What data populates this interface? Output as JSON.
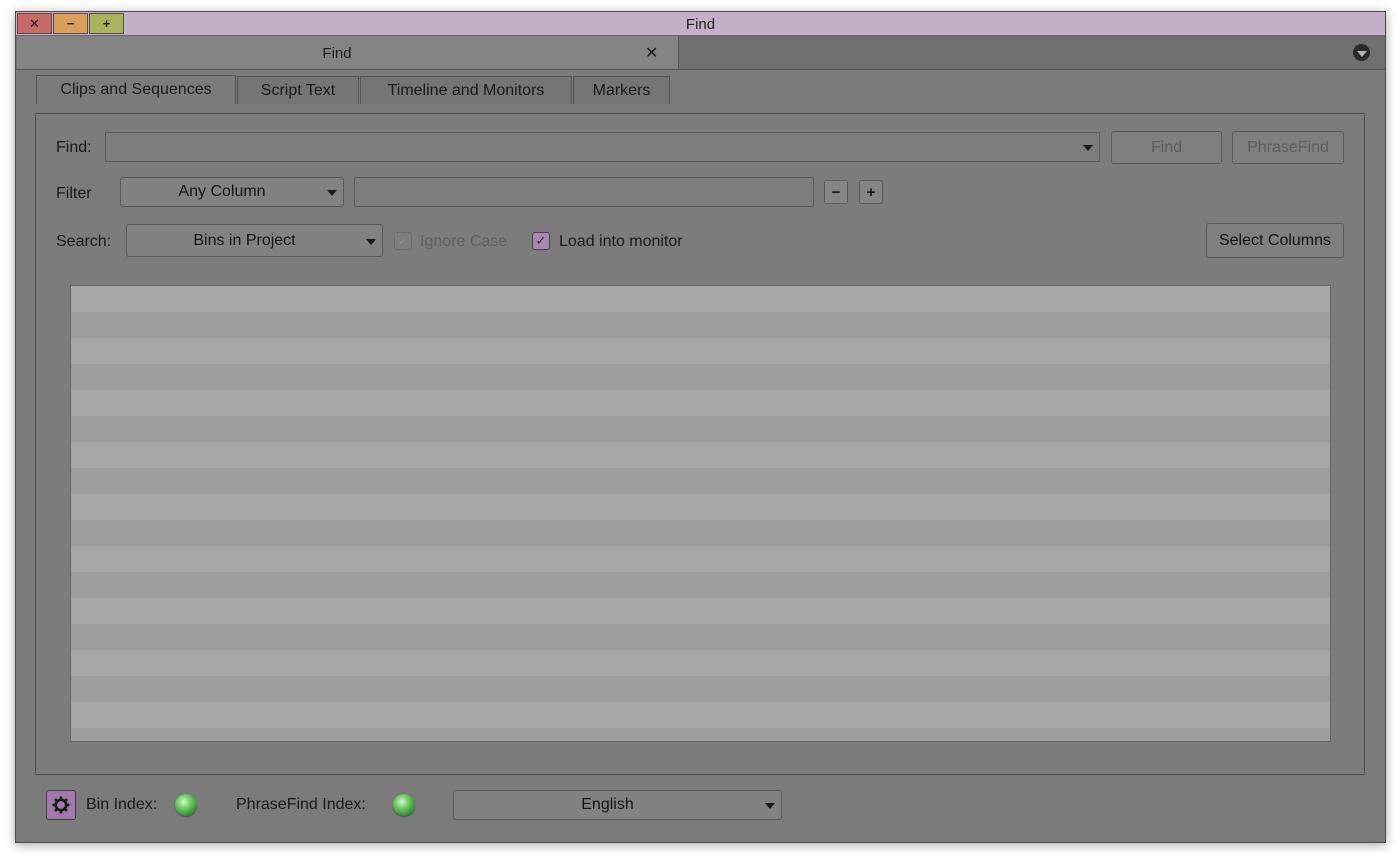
{
  "window": {
    "title": "Find",
    "controls": {
      "close": "✕",
      "minimize": "−",
      "maximize": "+"
    }
  },
  "doc_tab": {
    "label": "Find",
    "close_glyph": "✕",
    "menu_icon": "dropdown-menu-icon"
  },
  "tabs": [
    {
      "label": "Clips and Sequences",
      "active": true
    },
    {
      "label": "Script Text",
      "active": false
    },
    {
      "label": "Timeline and Monitors",
      "active": false
    },
    {
      "label": "Markers",
      "active": false
    }
  ],
  "find_row": {
    "label": "Find:",
    "value": "",
    "find_button": "Find",
    "phrasefind_button": "PhraseFind"
  },
  "filter_row": {
    "label": "Filter",
    "column_selected": "Any Column",
    "value": "",
    "remove_glyph": "−",
    "add_glyph": "+"
  },
  "search_row": {
    "label": "Search:",
    "scope_selected": "Bins in Project",
    "ignore_case_label": "Ignore Case",
    "ignore_case_checked": true,
    "ignore_case_disabled": true,
    "load_monitor_label": "Load into monitor",
    "load_monitor_checked": true,
    "select_columns_button": "Select Columns"
  },
  "results": {
    "rows": []
  },
  "statusbar": {
    "bin_index_label": "Bin Index:",
    "phrasefind_index_label": "PhraseFind Index:",
    "language_selected": "English",
    "indicator_color": "#4cb847",
    "gear_color": "#a07aa8"
  }
}
